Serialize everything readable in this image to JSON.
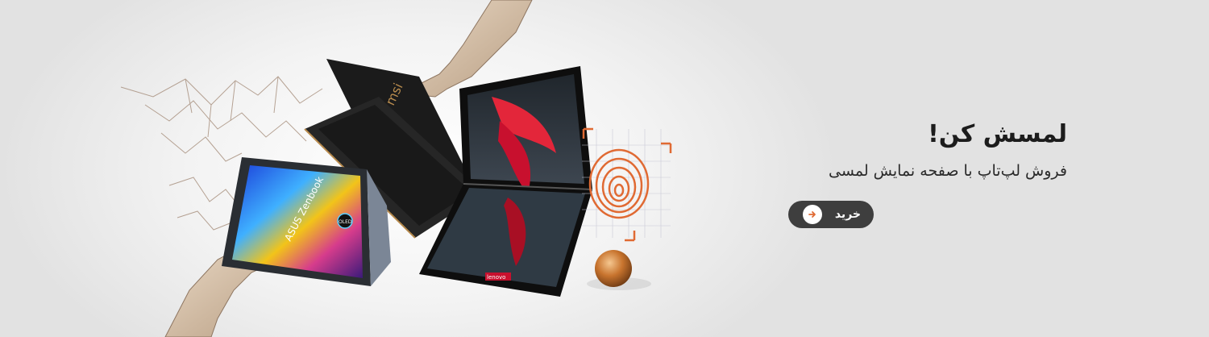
{
  "promo": {
    "title": "لمسش کن!",
    "subtitle": "فروش لپ‌تاپ با صفحه نمایش لمسی",
    "buy_label": "خرید"
  },
  "artwork": {
    "laptop_brand_text": "ASUS Zenbook",
    "badge_text": "OLED",
    "msi_logo": "msi",
    "lenovo_logo": "lenovo",
    "icons": [
      "arrow-right-icon",
      "fingerprint-icon"
    ]
  },
  "colors": {
    "accent": "#e06a33",
    "button_bg": "#3e3e3e",
    "title_text": "#1c1c1c"
  }
}
